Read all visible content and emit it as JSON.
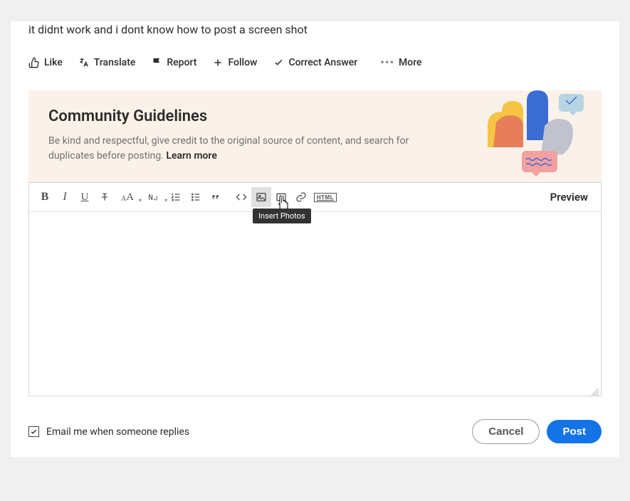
{
  "post": {
    "body": "it didnt work and i dont know how to post a screen shot"
  },
  "actions": {
    "like": "Like",
    "translate": "Translate",
    "report": "Report",
    "follow": "Follow",
    "correct_answer": "Correct Answer",
    "more": "More"
  },
  "guidelines": {
    "title": "Community Guidelines",
    "body": "Be kind and respectful, give credit to the original source of content, and search for duplicates before posting. ",
    "learn_more": "Learn more"
  },
  "editor": {
    "preview_label": "Preview",
    "tooltip_insert_photos": "Insert Photos",
    "html_label": "HTML"
  },
  "footer": {
    "email_checkbox_label": "Email me when someone replies",
    "email_checked": true,
    "cancel_label": "Cancel",
    "post_label": "Post"
  }
}
